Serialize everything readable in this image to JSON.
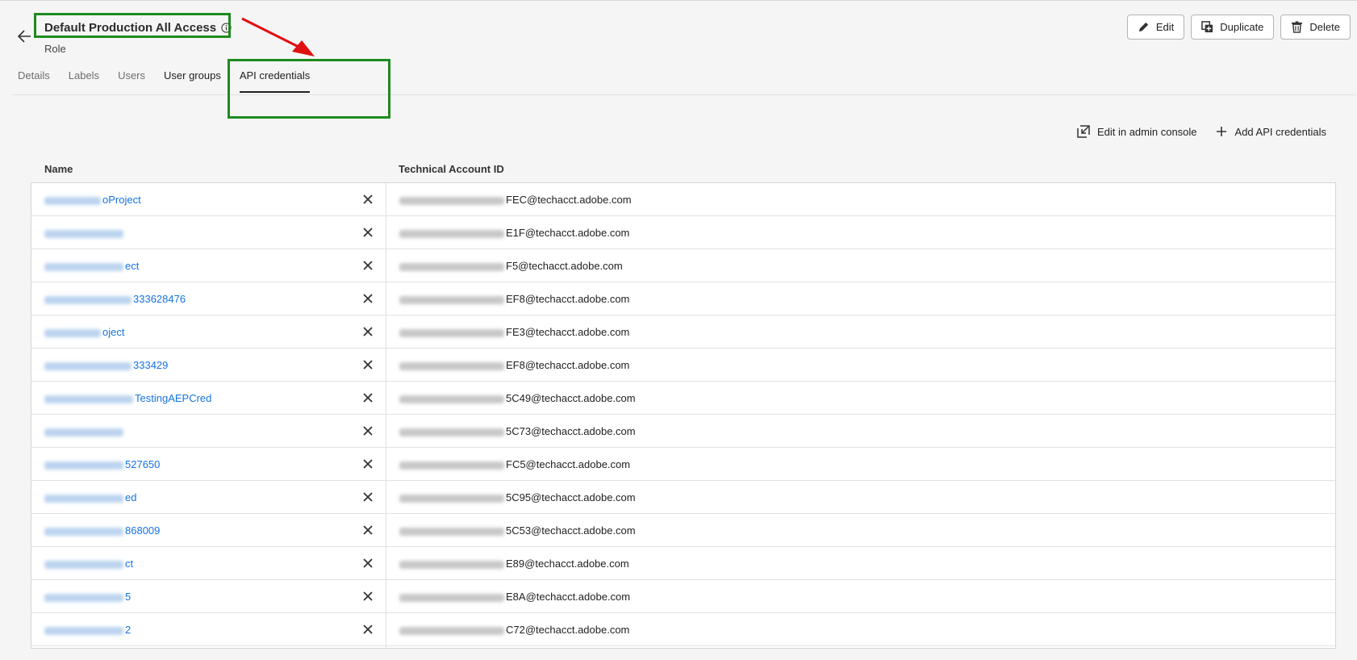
{
  "header": {
    "title": "Default Production All Access",
    "subtitle": "Role"
  },
  "actions": {
    "edit_label": "Edit",
    "duplicate_label": "Duplicate",
    "delete_label": "Delete"
  },
  "tabs": [
    {
      "label": "Details"
    },
    {
      "label": "Labels"
    },
    {
      "label": "Users"
    },
    {
      "label": "User groups"
    },
    {
      "label": "API credentials"
    }
  ],
  "toolbar": {
    "edit_admin_label": "Edit in admin console",
    "add_label": "Add API credentials"
  },
  "table": {
    "columns": [
      "Name",
      "Technical Account ID"
    ],
    "rows": [
      {
        "name": "oProject",
        "tech": "FEC@techacct.adobe.com"
      },
      {
        "name": "",
        "tech": "E1F@techacct.adobe.com"
      },
      {
        "name": "ect",
        "tech": "F5@techacct.adobe.com"
      },
      {
        "name": "333628476",
        "tech": "EF8@techacct.adobe.com"
      },
      {
        "name": "oject",
        "tech": "FE3@techacct.adobe.com"
      },
      {
        "name": "333429",
        "tech": "EF8@techacct.adobe.com"
      },
      {
        "name": "TestingAEPCred",
        "tech": "5C49@techacct.adobe.com"
      },
      {
        "name": "",
        "tech": "5C73@techacct.adobe.com"
      },
      {
        "name": "527650",
        "tech": "FC5@techacct.adobe.com"
      },
      {
        "name": "ed",
        "tech": "5C95@techacct.adobe.com"
      },
      {
        "name": "868009",
        "tech": "5C53@techacct.adobe.com"
      },
      {
        "name": "ct",
        "tech": "E89@techacct.adobe.com"
      },
      {
        "name": "5",
        "tech": "E8A@techacct.adobe.com"
      },
      {
        "name": "2",
        "tech": "C72@techacct.adobe.com"
      }
    ]
  },
  "colors": {
    "link": "#1473e6",
    "highlight": "#1e8a1e",
    "arrow": "#e01010"
  }
}
